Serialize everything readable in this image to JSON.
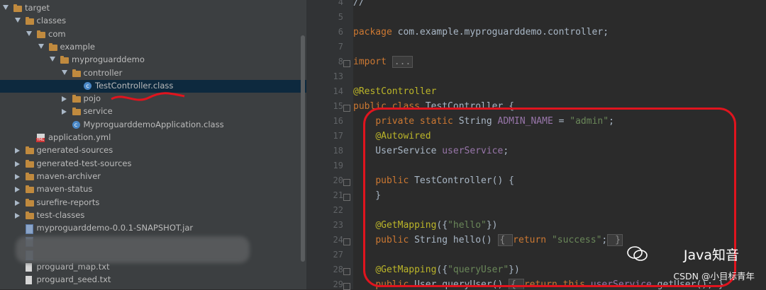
{
  "tree": [
    {
      "label": "target",
      "indent": 0,
      "arrow": "down",
      "icon": "folder"
    },
    {
      "label": "classes",
      "indent": 1,
      "arrow": "down",
      "icon": "folder"
    },
    {
      "label": "com",
      "indent": 2,
      "arrow": "down",
      "icon": "folder"
    },
    {
      "label": "example",
      "indent": 3,
      "arrow": "down",
      "icon": "folder"
    },
    {
      "label": "myproguarddemo",
      "indent": 4,
      "arrow": "down",
      "icon": "folder"
    },
    {
      "label": "controller",
      "indent": 5,
      "arrow": "down",
      "icon": "folder"
    },
    {
      "label": "TestController.class",
      "indent": 6,
      "arrow": "none",
      "icon": "class",
      "selected": true
    },
    {
      "label": "pojo",
      "indent": 5,
      "arrow": "right",
      "icon": "folder"
    },
    {
      "label": "service",
      "indent": 5,
      "arrow": "right",
      "icon": "folder"
    },
    {
      "label": "MyproguarddemoApplication.class",
      "indent": 5,
      "arrow": "none",
      "icon": "class"
    },
    {
      "label": "application.yml",
      "indent": 2,
      "arrow": "none",
      "icon": "yml"
    },
    {
      "label": "generated-sources",
      "indent": 1,
      "arrow": "right",
      "icon": "folder"
    },
    {
      "label": "generated-test-sources",
      "indent": 1,
      "arrow": "right",
      "icon": "folder"
    },
    {
      "label": "maven-archiver",
      "indent": 1,
      "arrow": "right",
      "icon": "folder"
    },
    {
      "label": "maven-status",
      "indent": 1,
      "arrow": "right",
      "icon": "folder"
    },
    {
      "label": "surefire-reports",
      "indent": 1,
      "arrow": "right",
      "icon": "folder"
    },
    {
      "label": "test-classes",
      "indent": 1,
      "arrow": "right",
      "icon": "folder"
    },
    {
      "label": "myproguarddemo-0.0.1-SNAPSHOT.jar",
      "indent": 1,
      "arrow": "none",
      "icon": "jar"
    },
    {
      "label": "",
      "indent": 1,
      "arrow": "none",
      "icon": "jar"
    },
    {
      "label": "",
      "indent": 1,
      "arrow": "none",
      "icon": "jar"
    },
    {
      "label": "proguard_map.txt",
      "indent": 1,
      "arrow": "none",
      "icon": "txt"
    },
    {
      "label": "proguard_seed.txt",
      "indent": 1,
      "arrow": "none",
      "icon": "txt"
    }
  ],
  "lines": [
    {
      "n": "4",
      "tokens": [
        [
          "",
          "//"
        ]
      ]
    },
    {
      "n": "5",
      "tokens": []
    },
    {
      "n": "6",
      "tokens": [
        [
          "kw",
          "package "
        ],
        [
          "",
          "com.example.myproguarddemo.controller;"
        ]
      ]
    },
    {
      "n": "7",
      "tokens": []
    },
    {
      "n": "8",
      "tokens": [
        [
          "kw",
          "import "
        ],
        [
          "collapsed",
          "..."
        ]
      ]
    },
    {
      "n": "13",
      "tokens": []
    },
    {
      "n": "14",
      "tokens": [
        [
          "an",
          "@RestController"
        ]
      ]
    },
    {
      "n": "15",
      "tokens": [
        [
          "kw",
          "public class "
        ],
        [
          "",
          "TestController {"
        ]
      ]
    },
    {
      "n": "16",
      "tokens": [
        [
          "",
          "    "
        ],
        [
          "kw",
          "private static "
        ],
        [
          "",
          "String "
        ],
        [
          "fd",
          "ADMIN_NAME"
        ],
        [
          "",
          " = "
        ],
        [
          "st",
          "\"admin\""
        ],
        [
          "",
          ";"
        ]
      ]
    },
    {
      "n": "17",
      "tokens": [
        [
          "",
          "    "
        ],
        [
          "an",
          "@Autowired"
        ]
      ]
    },
    {
      "n": "18",
      "tokens": [
        [
          "",
          "    UserService "
        ],
        [
          "fd",
          "userService"
        ],
        [
          "",
          ";"
        ]
      ]
    },
    {
      "n": "19",
      "tokens": []
    },
    {
      "n": "20",
      "tokens": [
        [
          "",
          "    "
        ],
        [
          "kw",
          "public "
        ],
        [
          "",
          "TestController() {"
        ]
      ]
    },
    {
      "n": "21",
      "tokens": [
        [
          "",
          "    }"
        ]
      ]
    },
    {
      "n": "22",
      "tokens": []
    },
    {
      "n": "23",
      "tokens": [
        [
          "",
          "    "
        ],
        [
          "an",
          "@GetMapping"
        ],
        [
          "",
          "({"
        ],
        [
          "st",
          "\"hello\""
        ],
        [
          "",
          "})"
        ]
      ]
    },
    {
      "n": "24",
      "tokens": [
        [
          "",
          "    "
        ],
        [
          "kw",
          "public "
        ],
        [
          "",
          "String hello() "
        ],
        [
          "collapsed",
          "{ "
        ],
        [
          "kw",
          "return "
        ],
        [
          "st",
          "\"success\""
        ],
        [
          "",
          ";"
        ],
        [
          "collapsed",
          " }"
        ]
      ]
    },
    {
      "n": "27",
      "tokens": []
    },
    {
      "n": "28",
      "tokens": [
        [
          "",
          "    "
        ],
        [
          "an",
          "@GetMapping"
        ],
        [
          "",
          "({"
        ],
        [
          "st",
          "\"queryUser\""
        ],
        [
          "",
          "})"
        ]
      ]
    },
    {
      "n": "29",
      "tokens": [
        [
          "",
          "    "
        ],
        [
          "kw",
          "public "
        ],
        [
          "",
          "User queryUser() "
        ],
        [
          "collapsed",
          "{ "
        ],
        [
          "kw",
          "return this"
        ],
        [
          "",
          "."
        ],
        [
          "fd",
          "userService"
        ],
        [
          "",
          ".getUser(); }"
        ]
      ]
    }
  ],
  "folds": [
    "8",
    "15",
    "20",
    "21",
    "24",
    "28",
    "29"
  ],
  "watermark": {
    "brand": "Java知音",
    "csdn": "CSDN @小目标青年"
  },
  "colors": {
    "annotation": "#e0141e",
    "selection": "#0d293e"
  }
}
